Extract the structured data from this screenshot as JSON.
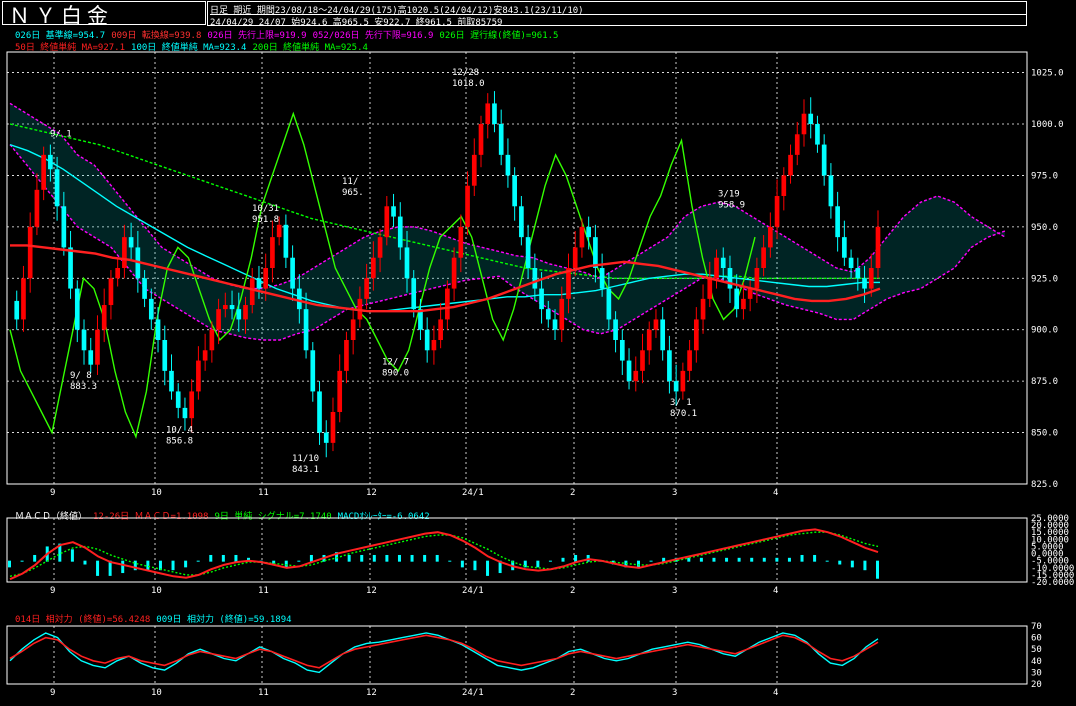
{
  "title": "ＮＹ白金",
  "header": {
    "line1_type": "日足 期近",
    "line1_period": "期間23/08/18～24/04/29(175)高1020.5(24/04/12)安843.1(23/11/10)",
    "line2": "24/04/29 24/07 始924.6 高965.5 安922.7 終961.5 前取85759"
  },
  "legend_main_1": [
    {
      "text": "026日 基準線=954.7",
      "color": "#00ffff"
    },
    {
      "text": "009日 転換線=939.8",
      "color": "#ff3030"
    },
    {
      "text": "026日 先行上限=919.9",
      "color": "#ff00ff"
    },
    {
      "text": "052/026日 先行下限=916.9",
      "color": "#ff00ff"
    },
    {
      "text": "026日 遅行線(終値)=961.5",
      "color": "#00ff00"
    }
  ],
  "legend_main_2": [
    {
      "text": "50日 終値単純 MA=927.1",
      "color": "#ff2020"
    },
    {
      "text": "100日 終値単純 MA=923.4",
      "color": "#00ffff"
    },
    {
      "text": "200日 終値単純 MA=925.4",
      "color": "#00ff00"
    }
  ],
  "legend_macd": [
    {
      "text": "ＭＡＣＤ（終値）",
      "color": "#ffffff"
    },
    {
      "text": "12-26日 ＭＡＣＤ=1.1098",
      "color": "#ff2020"
    },
    {
      "text": "9日 単純 シグナル=7.1740",
      "color": "#00ff00"
    },
    {
      "text": "MACDｵｼﾚｰﾀｰ=-6.0642",
      "color": "#00ffff"
    }
  ],
  "legend_rsi": [
    {
      "text": "014日 相対力 (終値)=56.4248",
      "color": "#ff2020"
    },
    {
      "text": "009日 相対力 (終値)=59.1894",
      "color": "#00ffff"
    }
  ],
  "colors": {
    "up": "#ff0000",
    "down": "#00ffff",
    "ma50": "#ff2020",
    "ma100": "#00ffff",
    "ma200": "#00ff00",
    "cloud": "#ff00ff",
    "lagging": "#33ff00"
  },
  "chart_data": [
    {
      "type": "candlestick",
      "title": "ＮＹ白金 日足 期近",
      "x_tick_labels": [
        "9",
        "10",
        "11",
        "12",
        "24/1",
        "2",
        "3",
        "4"
      ],
      "y_ticks": [
        825,
        850,
        875,
        900,
        925,
        950,
        975,
        1000,
        1025
      ],
      "ylim": [
        825,
        1035
      ],
      "grid": true,
      "annotations": [
        {
          "date": "9/1",
          "value": 988.0,
          "label": "9/ 1"
        },
        {
          "date": "9/8",
          "value": 883.3,
          "label": "9/ 8\n883.3"
        },
        {
          "date": "10/4",
          "value": 856.8,
          "label": "10/ 4\n856.8"
        },
        {
          "date": "10/31",
          "value": 951.8,
          "label": "10/31\n951.8"
        },
        {
          "date": "11/10",
          "value": 843.1,
          "label": "11/10\n843.1"
        },
        {
          "date": "11/?",
          "value": 965.0,
          "label": "11/\n965."
        },
        {
          "date": "12/7",
          "value": 890.0,
          "label": "12/ 7\n890.0"
        },
        {
          "date": "12/28",
          "value": 1018.0,
          "label": "12/28\n1018.0"
        },
        {
          "date": "3/1",
          "value": 870.1,
          "label": "3/ 1\n870.1"
        },
        {
          "date": "3/19",
          "value": 958.9,
          "label": "3/19\n958.9"
        }
      ],
      "close_path": [
        914,
        905,
        925,
        950,
        968,
        985,
        978,
        960,
        940,
        920,
        900,
        890,
        883,
        900,
        912,
        925,
        930,
        945,
        940,
        925,
        915,
        905,
        895,
        880,
        870,
        862,
        857,
        870,
        885,
        890,
        900,
        910,
        912,
        910,
        905,
        912,
        925,
        920,
        930,
        945,
        951,
        935,
        920,
        910,
        890,
        870,
        850,
        845,
        860,
        880,
        895,
        905,
        915,
        925,
        935,
        945,
        960,
        955,
        940,
        925,
        910,
        900,
        890,
        895,
        905,
        920,
        935,
        950,
        970,
        985,
        1000,
        1010,
        1000,
        985,
        975,
        960,
        945,
        930,
        920,
        910,
        905,
        900,
        915,
        930,
        940,
        950,
        945,
        930,
        920,
        905,
        895,
        885,
        875,
        880,
        890,
        900,
        905,
        890,
        875,
        870,
        880,
        890,
        905,
        915,
        925,
        935,
        930,
        920,
        910,
        915,
        920,
        930,
        940,
        950,
        965,
        975,
        985,
        995,
        1005,
        1000,
        990,
        975,
        960,
        945,
        935,
        930,
        925,
        920,
        930,
        950
      ],
      "ma50_path": [
        941,
        941,
        940,
        939,
        938,
        937,
        935,
        934,
        932,
        930,
        928,
        926,
        924,
        922,
        920,
        918,
        916,
        914,
        912,
        911,
        910,
        909,
        909,
        909,
        909,
        910,
        911,
        913,
        915,
        918,
        921,
        924,
        927,
        929,
        931,
        932,
        933,
        932,
        931,
        929,
        927,
        925,
        923,
        921,
        919,
        917,
        915,
        914,
        914,
        915,
        917,
        920
      ],
      "ma100_path": [
        990,
        987,
        983,
        978,
        972,
        966,
        960,
        955,
        950,
        945,
        940,
        936,
        932,
        928,
        924,
        920,
        917,
        914,
        912,
        910,
        909,
        909,
        910,
        911,
        912,
        913,
        914,
        915,
        916,
        916,
        917,
        917,
        918,
        919,
        921,
        923,
        925,
        926,
        927,
        927,
        926,
        925,
        924,
        923,
        922,
        921,
        921,
        922,
        923,
        923
      ],
      "ma200_path": [
        1000,
        998,
        996,
        994,
        992,
        990,
        987,
        984,
        981,
        978,
        975,
        972,
        969,
        966,
        963,
        960,
        957,
        954,
        952,
        950,
        948,
        946,
        944,
        942,
        940,
        938,
        936,
        934,
        932,
        930,
        929,
        928,
        927,
        926,
        925,
        925,
        925,
        925,
        925,
        925,
        926,
        926,
        925,
        925,
        925,
        925,
        925,
        925,
        925,
        925
      ],
      "cloud_upper_path": [
        1010,
        1005,
        1000,
        995,
        985,
        980,
        970,
        960,
        950,
        940,
        935,
        930,
        925,
        922,
        920,
        920,
        922,
        925,
        930,
        935,
        940,
        945,
        948,
        950,
        950,
        948,
        945,
        942,
        940,
        938,
        936,
        935,
        932,
        930,
        928,
        925,
        930,
        935,
        940,
        945,
        955,
        960,
        962,
        960,
        955,
        950,
        945,
        940,
        935,
        930,
        928,
        935,
        945,
        955,
        962,
        965,
        962,
        955,
        950,
        945
      ],
      "cloud_lower_path": [
        990,
        980,
        970,
        960,
        950,
        945,
        940,
        930,
        920,
        915,
        910,
        905,
        900,
        898,
        896,
        895,
        895,
        898,
        900,
        905,
        910,
        912,
        914,
        916,
        918,
        920,
        922,
        924,
        925,
        926,
        920,
        915,
        910,
        905,
        900,
        898,
        900,
        905,
        910,
        915,
        920,
        925,
        925,
        922,
        918,
        915,
        912,
        910,
        908,
        905,
        905,
        910,
        915,
        918,
        920,
        925,
        930,
        940,
        945,
        948
      ],
      "lagging_path": [
        900,
        880,
        870,
        860,
        850,
        875,
        900,
        925,
        920,
        905,
        880,
        860,
        848,
        870,
        905,
        930,
        940,
        935,
        920,
        905,
        895,
        900,
        915,
        935,
        960,
        975,
        990,
        1005,
        990,
        970,
        950,
        930,
        920,
        910,
        905,
        895,
        885,
        880,
        890,
        910,
        930,
        945,
        950,
        955,
        945,
        925,
        905,
        895,
        910,
        930,
        950,
        970,
        985,
        975,
        960,
        945,
        930,
        920,
        915,
        925,
        940,
        955,
        965,
        980,
        992,
        960,
        935,
        915,
        905,
        910,
        925,
        945
      ]
    },
    {
      "type": "line",
      "title": "ＭＡＣＤ（終値）",
      "y_tick_labels": [
        "25.0000",
        "20.0000",
        "15.0000",
        "10.0000",
        "5.0000",
        "0.0000",
        "-5.0000",
        "-10.0000",
        "-15.0000",
        "-20.0000"
      ],
      "ylim": [
        -20,
        25
      ],
      "series": [
        {
          "name": "12-26日 ＭＡＣＤ",
          "latest": 1.1098,
          "values": [
            -18,
            -14,
            -8,
            0,
            6,
            8,
            4,
            -2,
            -6,
            -8,
            -10,
            -12,
            -14,
            -16,
            -17,
            -15,
            -11,
            -8,
            -6,
            -5,
            -6,
            -8,
            -10,
            -9,
            -6,
            -3,
            0,
            2,
            4,
            6,
            8,
            10,
            12,
            14,
            15,
            13,
            9,
            4,
            -2,
            -6,
            -9,
            -11,
            -12,
            -11,
            -9,
            -6,
            -4,
            -5,
            -7,
            -9,
            -10,
            -8,
            -6,
            -4,
            -2,
            0,
            2,
            4,
            6,
            8,
            10,
            12,
            14,
            16,
            17,
            15,
            12,
            8,
            4,
            1
          ]
        },
        {
          "name": "9日 単純 シグナル",
          "latest": 7.174,
          "values": [
            -16,
            -14,
            -10,
            -5,
            0,
            4,
            5,
            3,
            -1,
            -4,
            -7,
            -9,
            -11,
            -13,
            -15,
            -15,
            -13,
            -10,
            -8,
            -6,
            -6,
            -7,
            -8,
            -9,
            -8,
            -5,
            -3,
            0,
            2,
            4,
            6,
            8,
            10,
            12,
            13,
            13,
            11,
            7,
            3,
            -2,
            -6,
            -9,
            -10,
            -11,
            -10,
            -8,
            -6,
            -5,
            -6,
            -7,
            -8,
            -8,
            -7,
            -5,
            -3,
            -1,
            1,
            3,
            5,
            7,
            9,
            11,
            13,
            14,
            15,
            15,
            13,
            10,
            7,
            5
          ]
        },
        {
          "name": "MACDｵｼﾚｰﾀｰ",
          "latest": -6.0642,
          "values": [
            -2,
            0,
            2,
            5,
            6,
            4,
            -1,
            -5,
            -5,
            -4,
            -3,
            -3,
            -3,
            -3,
            -2,
            0,
            2,
            2,
            2,
            1,
            0,
            -1,
            -2,
            0,
            2,
            2,
            3,
            2,
            2,
            2,
            2,
            2,
            2,
            2,
            2,
            0,
            -2,
            -3,
            -5,
            -4,
            -3,
            -2,
            -2,
            0,
            1,
            2,
            2,
            0,
            -1,
            -2,
            -2,
            0,
            1,
            1,
            1,
            1,
            1,
            1,
            1,
            1,
            1,
            1,
            1,
            2,
            2,
            0,
            -1,
            -2,
            -3,
            -6
          ]
        }
      ]
    },
    {
      "type": "line",
      "title": "相対力",
      "y_tick_labels": [
        "70",
        "60",
        "50",
        "40",
        "30",
        "20"
      ],
      "ylim": [
        20,
        70
      ],
      "series": [
        {
          "name": "014日 相対力 (終値)",
          "latest": 56.4248,
          "values": [
            42,
            48,
            55,
            60,
            58,
            50,
            44,
            40,
            38,
            42,
            44,
            40,
            38,
            36,
            40,
            45,
            48,
            46,
            44,
            42,
            46,
            50,
            48,
            44,
            40,
            36,
            34,
            40,
            46,
            50,
            52,
            54,
            56,
            58,
            60,
            62,
            60,
            58,
            55,
            50,
            44,
            40,
            38,
            36,
            38,
            40,
            42,
            46,
            48,
            46,
            44,
            42,
            44,
            46,
            48,
            50,
            52,
            54,
            52,
            50,
            48,
            46,
            50,
            54,
            58,
            62,
            60,
            55,
            48,
            42,
            40,
            44,
            50,
            56
          ]
        },
        {
          "name": "009日 相対力 (終値)",
          "latest": 59.1894,
          "values": [
            40,
            50,
            58,
            64,
            60,
            48,
            40,
            36,
            34,
            40,
            44,
            38,
            34,
            32,
            38,
            46,
            50,
            46,
            42,
            40,
            46,
            52,
            48,
            42,
            38,
            32,
            30,
            38,
            46,
            52,
            55,
            56,
            58,
            60,
            62,
            64,
            62,
            58,
            54,
            48,
            42,
            36,
            34,
            32,
            34,
            38,
            42,
            48,
            50,
            46,
            42,
            40,
            42,
            46,
            50,
            52,
            54,
            56,
            54,
            50,
            46,
            44,
            50,
            56,
            60,
            64,
            62,
            56,
            46,
            38,
            36,
            42,
            52,
            59
          ]
        }
      ]
    }
  ]
}
